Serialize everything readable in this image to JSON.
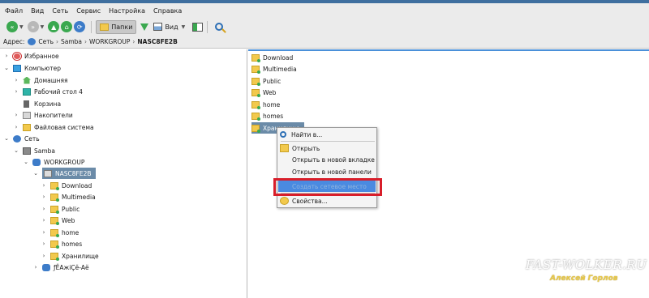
{
  "menu": [
    "Файл",
    "Вид",
    "Сеть",
    "Сервис",
    "Настройка",
    "Справка"
  ],
  "toolbar": {
    "folders_label": "Папки",
    "view_label": "Вид"
  },
  "address": {
    "label": "Адрес:",
    "crumbs": [
      "Сеть",
      "Samba",
      "WORKGROUP"
    ],
    "current": "NASC8FE2B"
  },
  "tree": {
    "favorites": "Избранное",
    "computer": "Компьютер",
    "home": "Домашняя",
    "desktop": "Рабочий стол 4",
    "trash": "Корзина",
    "drives": "Накопители",
    "filesystem": "Файловая система",
    "network": "Сеть",
    "samba": "Samba",
    "workgroup": "WORKGROUP",
    "nas": "NASC8FE2B",
    "shares": [
      "Download",
      "Multimedia",
      "Public",
      "Web",
      "home",
      "homes",
      "Хранилище"
    ],
    "other": "ƒЁАжіÇё-Аё"
  },
  "right_items": [
    "Download",
    "Multimedia",
    "Public",
    "Web",
    "home",
    "homes",
    "Хранилище"
  ],
  "context_menu": {
    "find": "Найти в...",
    "open": "Открыть",
    "open_tab": "Открыть в новой вкладке",
    "open_panel": "Открыть в новой панели",
    "create_network_place": "Создать сетевое место",
    "properties": "Свойства..."
  },
  "watermark": {
    "site": "FAST-WOLKER.RU",
    "author": "Алексей Горлов"
  },
  "colors": {
    "accent": "#4a90d9",
    "selection": "#6b8ba8",
    "highlight_border": "#d81e2a"
  }
}
